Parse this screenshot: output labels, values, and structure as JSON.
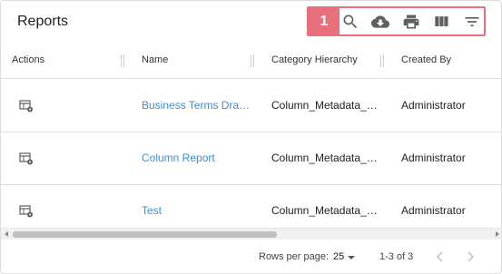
{
  "header": {
    "title": "Reports",
    "callout_number": "1",
    "toolbar": {
      "search_icon": "search-icon",
      "download_icon": "cloud-download-icon",
      "print_icon": "print-icon",
      "columns_icon": "view-columns-icon",
      "filter_icon": "filter-icon"
    },
    "callout_color": "#e8707c"
  },
  "table": {
    "columns": [
      "Actions",
      "Name",
      "Category Hierarchy",
      "Created By"
    ],
    "rows": [
      {
        "name": "Business Terms Draft…",
        "category": "Column_Metadata_R…",
        "created_by": "Administrator"
      },
      {
        "name": "Column Report",
        "category": "Column_Metadata_R…",
        "created_by": "Administrator"
      },
      {
        "name": "Test",
        "category": "Column_Metadata_R…",
        "created_by": "Administrator"
      }
    ],
    "action_icon": "table-view-icon",
    "link_color": "#3b8ed8"
  },
  "pagination": {
    "rows_per_page_label": "Rows per page:",
    "rows_per_page_value": "25",
    "range_label": "1-3 of 3"
  }
}
